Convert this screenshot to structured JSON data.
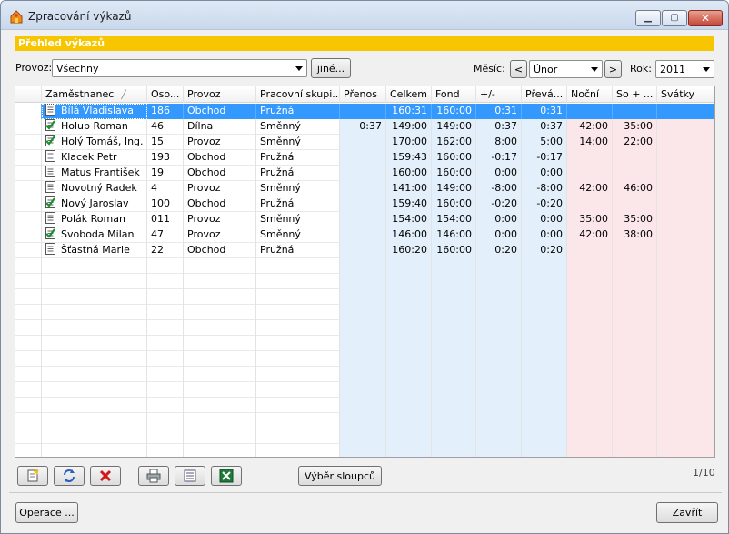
{
  "window": {
    "title": "Zpracování výkazů",
    "min_glyph": "▁",
    "max_glyph": "▢",
    "close_glyph": "✕"
  },
  "section_title": "Přehled výkazů",
  "filters": {
    "provoz_label": "Provoz:",
    "provoz_value": "Všechny",
    "other_button": "jiné...",
    "month_label": "Měsíc:",
    "month_prev": "<",
    "month_value": "Únor",
    "month_next": ">",
    "year_label": "Rok:",
    "year_value": "2011"
  },
  "table": {
    "headers": [
      "Zaměstnanec",
      "Oso...",
      "Provoz",
      "Pracovní skupi...",
      "Přenos",
      "Celkem",
      "Fond",
      "+/-",
      "Převá...",
      "Noční",
      "So + ...",
      "Svátky"
    ],
    "sort_indicator": "╱",
    "rows": [
      {
        "name": "Bílá Vladislava",
        "id": "186",
        "provoz": "Obchod",
        "group": "Pružná",
        "prenos": "",
        "celkem": "160:31",
        "fond": "160:00",
        "diff": "0:31",
        "prevod": "0:31",
        "nocni": "",
        "sobota": "",
        "svatky": "",
        "icon": "document-icon",
        "selected": true
      },
      {
        "name": "Holub Roman",
        "id": "46",
        "provoz": "Dílna",
        "group": "Směnný",
        "prenos": "0:37",
        "celkem": "149:00",
        "fond": "149:00",
        "diff": "0:37",
        "prevod": "0:37",
        "nocni": "42:00",
        "sobota": "35:00",
        "svatky": "",
        "icon": "document-approved-icon",
        "selected": false
      },
      {
        "name": "Holý Tomáš, Ing.",
        "id": "15",
        "provoz": "Provoz",
        "group": "Směnný",
        "prenos": "",
        "celkem": "170:00",
        "fond": "162:00",
        "diff": "8:00",
        "prevod": "5:00",
        "nocni": "14:00",
        "sobota": "22:00",
        "svatky": "",
        "icon": "document-approved-icon",
        "selected": false
      },
      {
        "name": "Klacek Petr",
        "id": "193",
        "provoz": "Obchod",
        "group": "Pružná",
        "prenos": "",
        "celkem": "159:43",
        "fond": "160:00",
        "diff": "-0:17",
        "prevod": "-0:17",
        "nocni": "",
        "sobota": "",
        "svatky": "",
        "icon": "document-icon",
        "selected": false
      },
      {
        "name": "Matus František",
        "id": "19",
        "provoz": "Obchod",
        "group": "Pružná",
        "prenos": "",
        "celkem": "160:00",
        "fond": "160:00",
        "diff": "0:00",
        "prevod": "0:00",
        "nocni": "",
        "sobota": "",
        "svatky": "",
        "icon": "document-icon",
        "selected": false
      },
      {
        "name": "Novotný Radek",
        "id": "4",
        "provoz": "Provoz",
        "group": "Směnný",
        "prenos": "",
        "celkem": "141:00",
        "fond": "149:00",
        "diff": "-8:00",
        "prevod": "-8:00",
        "nocni": "42:00",
        "sobota": "46:00",
        "svatky": "",
        "icon": "document-icon",
        "selected": false
      },
      {
        "name": "Nový Jaroslav",
        "id": "100",
        "provoz": "Obchod",
        "group": "Pružná",
        "prenos": "",
        "celkem": "159:40",
        "fond": "160:00",
        "diff": "-0:20",
        "prevod": "-0:20",
        "nocni": "",
        "sobota": "",
        "svatky": "",
        "icon": "document-approved-icon",
        "selected": false
      },
      {
        "name": "Polák Roman",
        "id": "011",
        "provoz": "Provoz",
        "group": "Směnný",
        "prenos": "",
        "celkem": "154:00",
        "fond": "154:00",
        "diff": "0:00",
        "prevod": "0:00",
        "nocni": "35:00",
        "sobota": "35:00",
        "svatky": "",
        "icon": "document-icon",
        "selected": false
      },
      {
        "name": "Svoboda Milan",
        "id": "47",
        "provoz": "Provoz",
        "group": "Směnný",
        "prenos": "",
        "celkem": "146:00",
        "fond": "146:00",
        "diff": "0:00",
        "prevod": "0:00",
        "nocni": "42:00",
        "sobota": "38:00",
        "svatky": "",
        "icon": "document-approved-icon",
        "selected": false
      },
      {
        "name": "Šťastná Marie",
        "id": "22",
        "provoz": "Obchod",
        "group": "Pružná",
        "prenos": "",
        "celkem": "160:20",
        "fond": "160:00",
        "diff": "0:20",
        "prevod": "0:20",
        "nocni": "",
        "sobota": "",
        "svatky": "",
        "icon": "document-icon",
        "selected": false
      }
    ]
  },
  "toolbar": {
    "columns_button": "Výběr sloupců",
    "pager": "1/10"
  },
  "footer": {
    "operations_button": "Operace ...",
    "close_button": "Zavřít"
  },
  "colors": {
    "header_bar": "#f7c600",
    "selection": "#3399ff",
    "blue_band": "#e3f0fb",
    "pink_band": "#fbe7ea"
  }
}
